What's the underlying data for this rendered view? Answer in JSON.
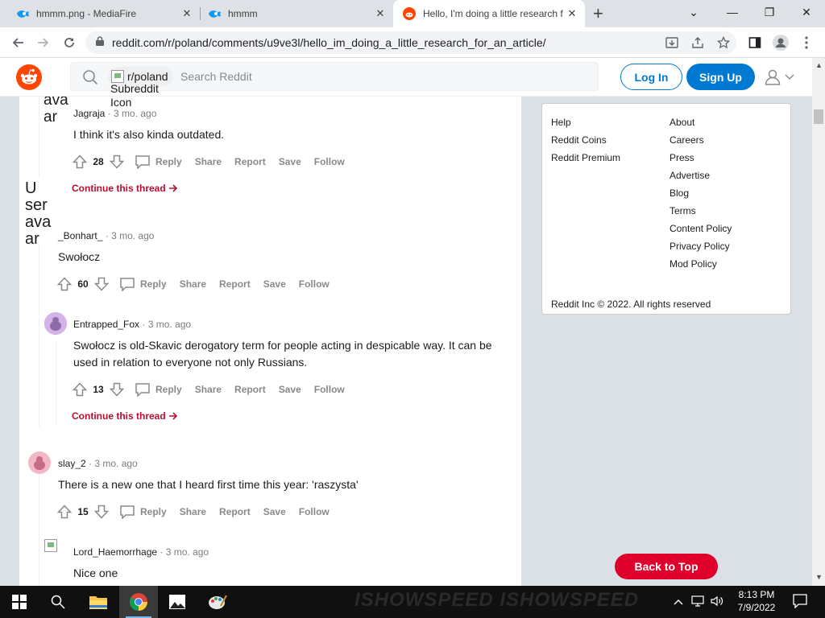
{
  "browser": {
    "tabs": [
      {
        "title": "hmmm.png - MediaFire"
      },
      {
        "title": "hmmm"
      },
      {
        "title": "Hello, I'm doing a little research f"
      }
    ],
    "new_tab": "+",
    "url": "reddit.com/r/poland/comments/u9ve3l/hello_im_doing_a_little_research_for_an_article/"
  },
  "header": {
    "subreddit_chip": "r/poland",
    "subreddit_icon_alt": "Subreddit Icon",
    "search_placeholder": "Search Reddit",
    "login": "Log In",
    "signup": "Sign Up"
  },
  "comments": [
    {
      "avatar_alt": "ava\nar",
      "user": "Jagraja",
      "time": "· 3 mo. ago",
      "body": "I think it's also kinda outdated.",
      "score": "28",
      "continue": "Continue this thread"
    },
    {
      "avatar_alt": "U\nser\nava\nar",
      "user": "_Bonhart_",
      "time": "· 3 mo. ago",
      "body": "Swołocz",
      "score": "60"
    },
    {
      "user": "Entrapped_Fox",
      "time": "· 3 mo. ago",
      "body": "Swołocz is old-Skavic derogatory term for people acting in despicable way. It can be used in relation to everyone not only Russians.",
      "score": "13",
      "continue": "Continue this thread"
    },
    {
      "user": "slay_2",
      "time": "· 3 mo. ago",
      "body": "There is a new one that I heard first time this year: 'raszysta'",
      "score": "15"
    },
    {
      "user": "Lord_Haemorrhage",
      "time": "· 3 mo. ago",
      "body": "Nice one"
    }
  ],
  "actions": {
    "reply": "Reply",
    "share": "Share",
    "report": "Report",
    "save": "Save",
    "follow": "Follow"
  },
  "sidebar": {
    "left_links": [
      "Help",
      "Reddit Coins",
      "Reddit Premium"
    ],
    "right_links": [
      "About",
      "Careers",
      "Press",
      "Advertise",
      "Blog",
      "Terms",
      "Content Policy",
      "Privacy Policy",
      "Mod Policy"
    ],
    "copyright": "Reddit Inc © 2022. All rights reserved"
  },
  "back_to_top": "Back to Top",
  "taskbar": {
    "time": "8:13 PM",
    "date": "7/9/2022",
    "watermark": "ISHOWSPEED  ISHOWSPEED"
  },
  "colors": {
    "reddit_orange": "#ff4500",
    "reddit_blue": "#0079d3",
    "back_to_top": "#e0002c",
    "continue": "#b60f33"
  }
}
